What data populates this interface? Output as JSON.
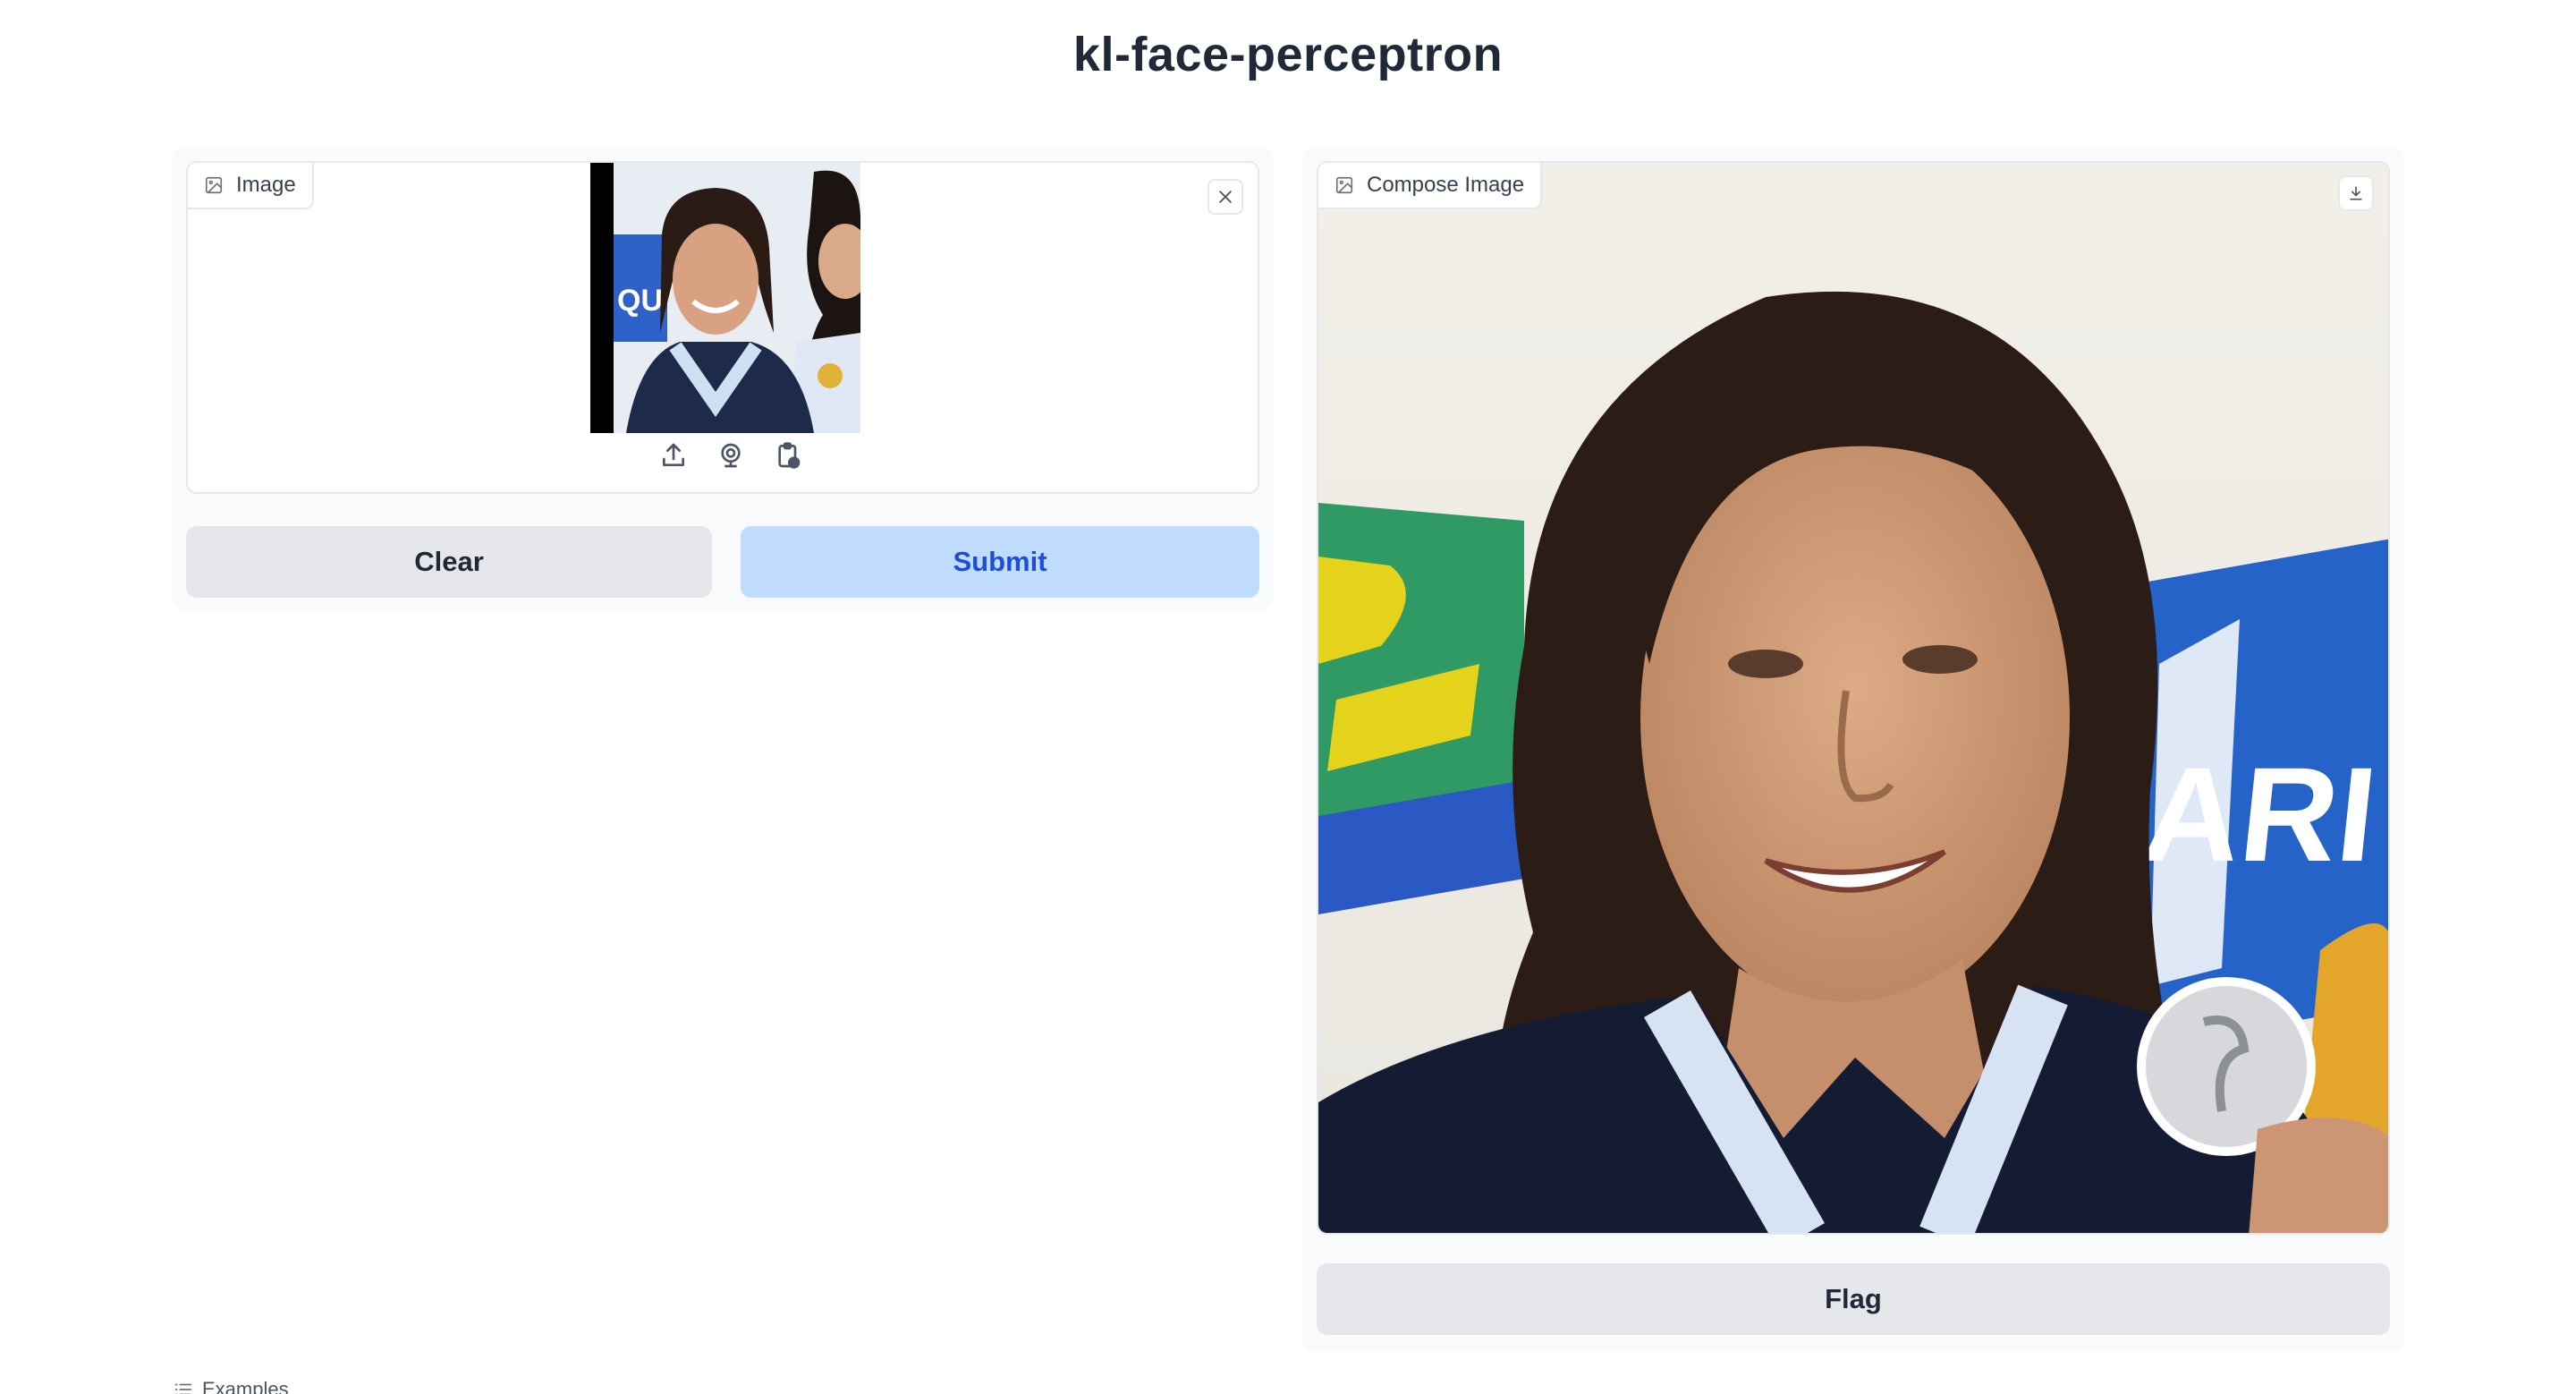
{
  "app": {
    "title": "kl-face-perceptron"
  },
  "input_panel": {
    "label": "Image",
    "label_icon": "image-icon",
    "clear_icon": "close-icon",
    "source_icons": [
      "upload-icon",
      "webcam-icon",
      "clipboard-icon"
    ],
    "buttons": {
      "clear": "Clear",
      "submit": "Submit"
    }
  },
  "output_panel": {
    "label": "Compose Image",
    "label_icon": "image-icon",
    "download_icon": "download-icon",
    "buttons": {
      "flag": "Flag"
    }
  },
  "examples": {
    "label": "Examples",
    "icon": "list-icon"
  },
  "colors": {
    "submit_bg": "#bfdbfe",
    "submit_text": "#1d4ed8",
    "secondary_bg": "#e5e7eb",
    "panel_bg": "#f9fafb"
  }
}
